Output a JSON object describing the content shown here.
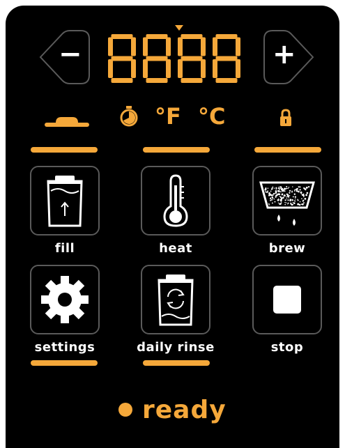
{
  "display": {
    "decrement_symbol": "−",
    "increment_symbol": "+",
    "readout": "8888"
  },
  "indicators": {
    "fahrenheit": "°F",
    "celsius": "°C"
  },
  "buttons": {
    "fill": "fill",
    "heat": "heat",
    "brew": "brew",
    "settings": "settings",
    "daily_rinse": "daily rinse",
    "stop": "stop"
  },
  "status": {
    "text": "ready"
  },
  "colors": {
    "accent": "#F5A83A",
    "panel": "#000000",
    "tile_border": "#5a5a5a",
    "icon": "#ffffff"
  },
  "icons": {
    "decrement": "minus-icon",
    "increment": "plus-icon",
    "lid": "lid-icon",
    "timer": "timer-icon",
    "lock": "lock-icon",
    "fill": "tank-fill-icon",
    "heat": "thermometer-icon",
    "brew": "brew-basket-icon",
    "settings": "gear-icon",
    "daily_rinse": "tank-rinse-icon",
    "stop": "stop-icon"
  }
}
